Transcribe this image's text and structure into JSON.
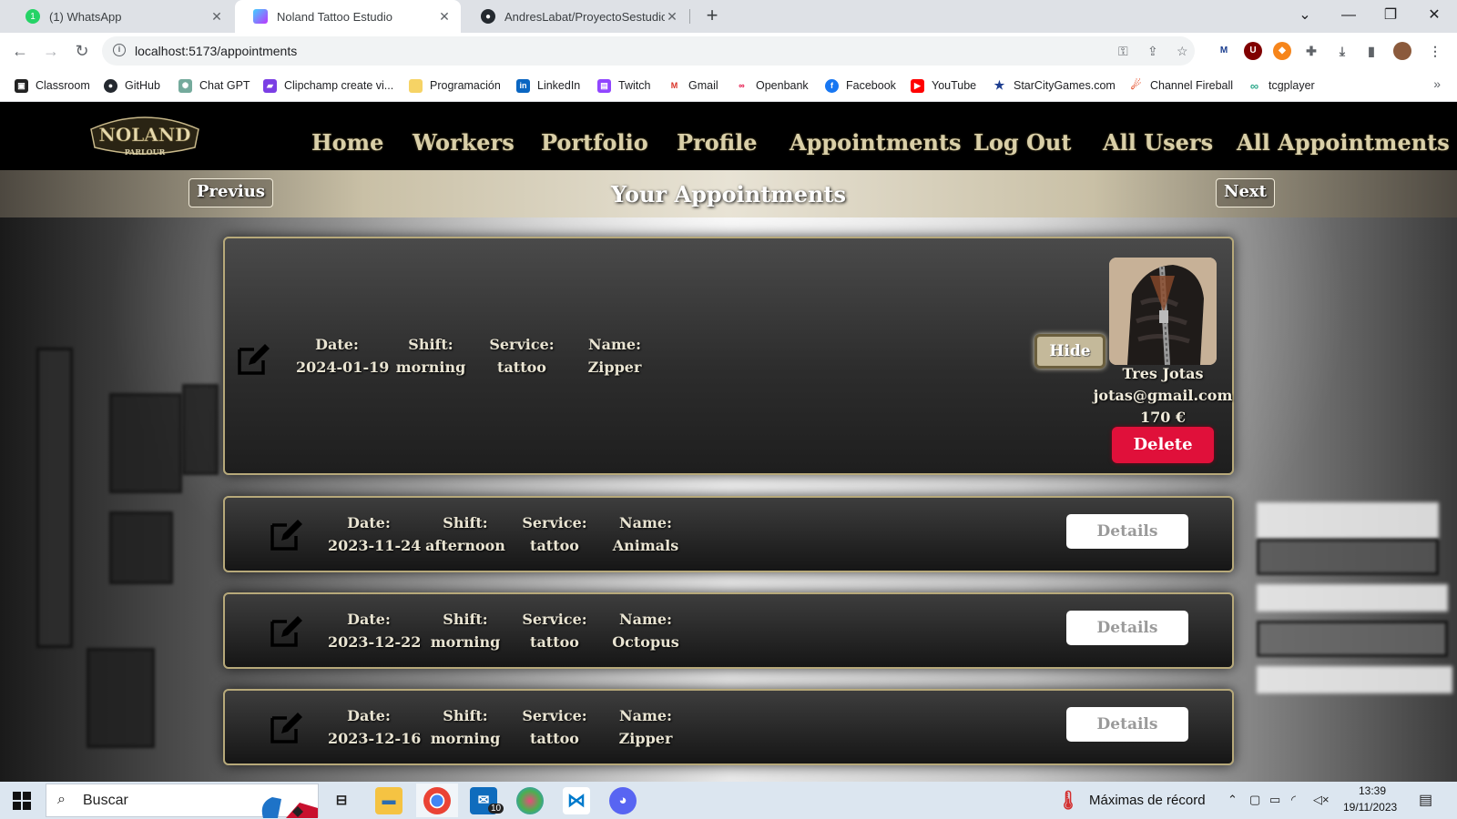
{
  "browser": {
    "tabs": [
      {
        "label": "(1) WhatsApp",
        "active": false
      },
      {
        "label": "Noland Tattoo Estudio",
        "active": true
      },
      {
        "label": "AndresLabat/ProyectoSestudioD",
        "active": false
      }
    ],
    "url": "localhost:5173/appointments",
    "bookmarks": [
      "Classroom",
      "GitHub",
      "Chat GPT",
      "Clipchamp create vi...",
      "Programación",
      "LinkedIn",
      "Twitch",
      "Gmail",
      "Openbank",
      "Facebook",
      "YouTube",
      "StarCityGames.com",
      "Channel Fireball",
      "tcgplayer"
    ],
    "more": "»"
  },
  "site": {
    "logo_text": "NOLAND",
    "logo_sub": "PARLOUR",
    "nav": [
      "Home",
      "Workers",
      "Portfolio",
      "Profile",
      "Appointments",
      "Log Out",
      "All Users",
      "All Appointments"
    ],
    "prev_label": "Previus",
    "next_label": "Next",
    "page_title": "Your Appointments"
  },
  "labels": {
    "date": "Date:",
    "shift": "Shift:",
    "service": "Service:",
    "name": "Name:",
    "details": "Details",
    "hide": "Hide",
    "delete": "Delete"
  },
  "appointments": [
    {
      "date": "2024-01-19",
      "shift": "morning",
      "service": "tattoo",
      "name": "Zipper",
      "expanded": true,
      "worker_name": "Tres Jotas",
      "worker_email": "jotas@gmail.com",
      "price": "170 €"
    },
    {
      "date": "2023-11-24",
      "shift": "afternoon",
      "service": "tattoo",
      "name": "Animals",
      "expanded": false
    },
    {
      "date": "2023-12-22",
      "shift": "morning",
      "service": "tattoo",
      "name": "Octopus",
      "expanded": false
    },
    {
      "date": "2023-12-16",
      "shift": "morning",
      "service": "tattoo",
      "name": "Zipper",
      "expanded": false
    }
  ],
  "taskbar": {
    "search_placeholder": "Buscar",
    "mail_badge": "10",
    "weather_text": "Máximas de récord",
    "time": "13:39",
    "date": "19/11/2023"
  },
  "colors": {
    "nav_gold": "#d9cfa8",
    "delete_red": "#e0103a",
    "card_border": "#b7a97a"
  }
}
